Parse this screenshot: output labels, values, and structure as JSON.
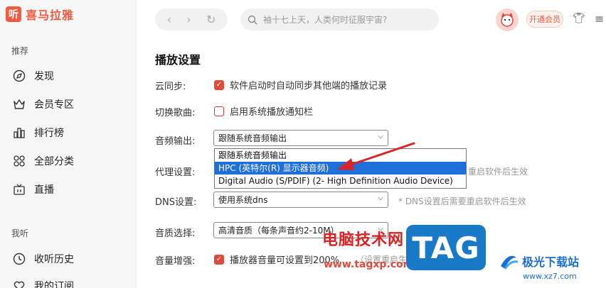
{
  "app": {
    "logo_glyph": "听",
    "logo_text": "喜马拉雅"
  },
  "sidebar": {
    "section_recommend": "推荐",
    "items": [
      {
        "label": "发现",
        "icon": "compass-icon"
      },
      {
        "label": "会员专区",
        "icon": "crown-icon"
      },
      {
        "label": "排行榜",
        "icon": "bar-chart-icon"
      },
      {
        "label": "全部分类",
        "icon": "grid-icon"
      },
      {
        "label": "直播",
        "icon": "tv-icon"
      }
    ],
    "section_mine": "我听",
    "mine_items": [
      {
        "label": "收听历史",
        "icon": "clock-icon"
      },
      {
        "label": "我的订阅",
        "icon": "heart-icon"
      }
    ]
  },
  "topbar": {
    "search_placeholder": "袖十七上天，人类何时征服宇宙?",
    "vip_label": "开通会员"
  },
  "settings": {
    "title": "播放设置",
    "cloud_sync": {
      "label": "云同步:",
      "option": "软件启动时自动同步其他端的播放记录",
      "checked": true
    },
    "switch_song": {
      "label": "切换歌曲:",
      "option": "启用系统播放通知栏",
      "checked": false
    },
    "audio_output": {
      "label": "音频输出:",
      "value": "跟随系统音频输出",
      "options": [
        "跟随系统音频输出",
        "HPC (英特尔(R) 显示器音频)",
        "Digital Audio (S/PDIF) (2- High Definition Audio Device)"
      ],
      "highlighted_index": 1
    },
    "proxy": {
      "label": "代理设置:",
      "hint": "重启软件后生效"
    },
    "dns": {
      "label": "DNS设置:",
      "value": "使用系统dns",
      "hint": "* DNS设置后需要重启软件后生效"
    },
    "quality": {
      "label": "音质选择:",
      "value": "高清音质（每条声音约2-10M）"
    },
    "volume_boost": {
      "label": "音量增强:",
      "option": "播放器音量可设置到200%",
      "hint": "（设置重启生效）",
      "checked": true
    }
  },
  "watermark": {
    "site_cn": "电脑技术网",
    "site_url": "www.tagxp.com",
    "tag_badge": "TAG",
    "brand2": "极光下载站",
    "brand2_url": "www.xz7.com"
  },
  "colors": {
    "accent": "#e04a3d",
    "selection": "#1e6fd9",
    "arrow": "#d6262a",
    "tag_blue": "#1879c9"
  }
}
